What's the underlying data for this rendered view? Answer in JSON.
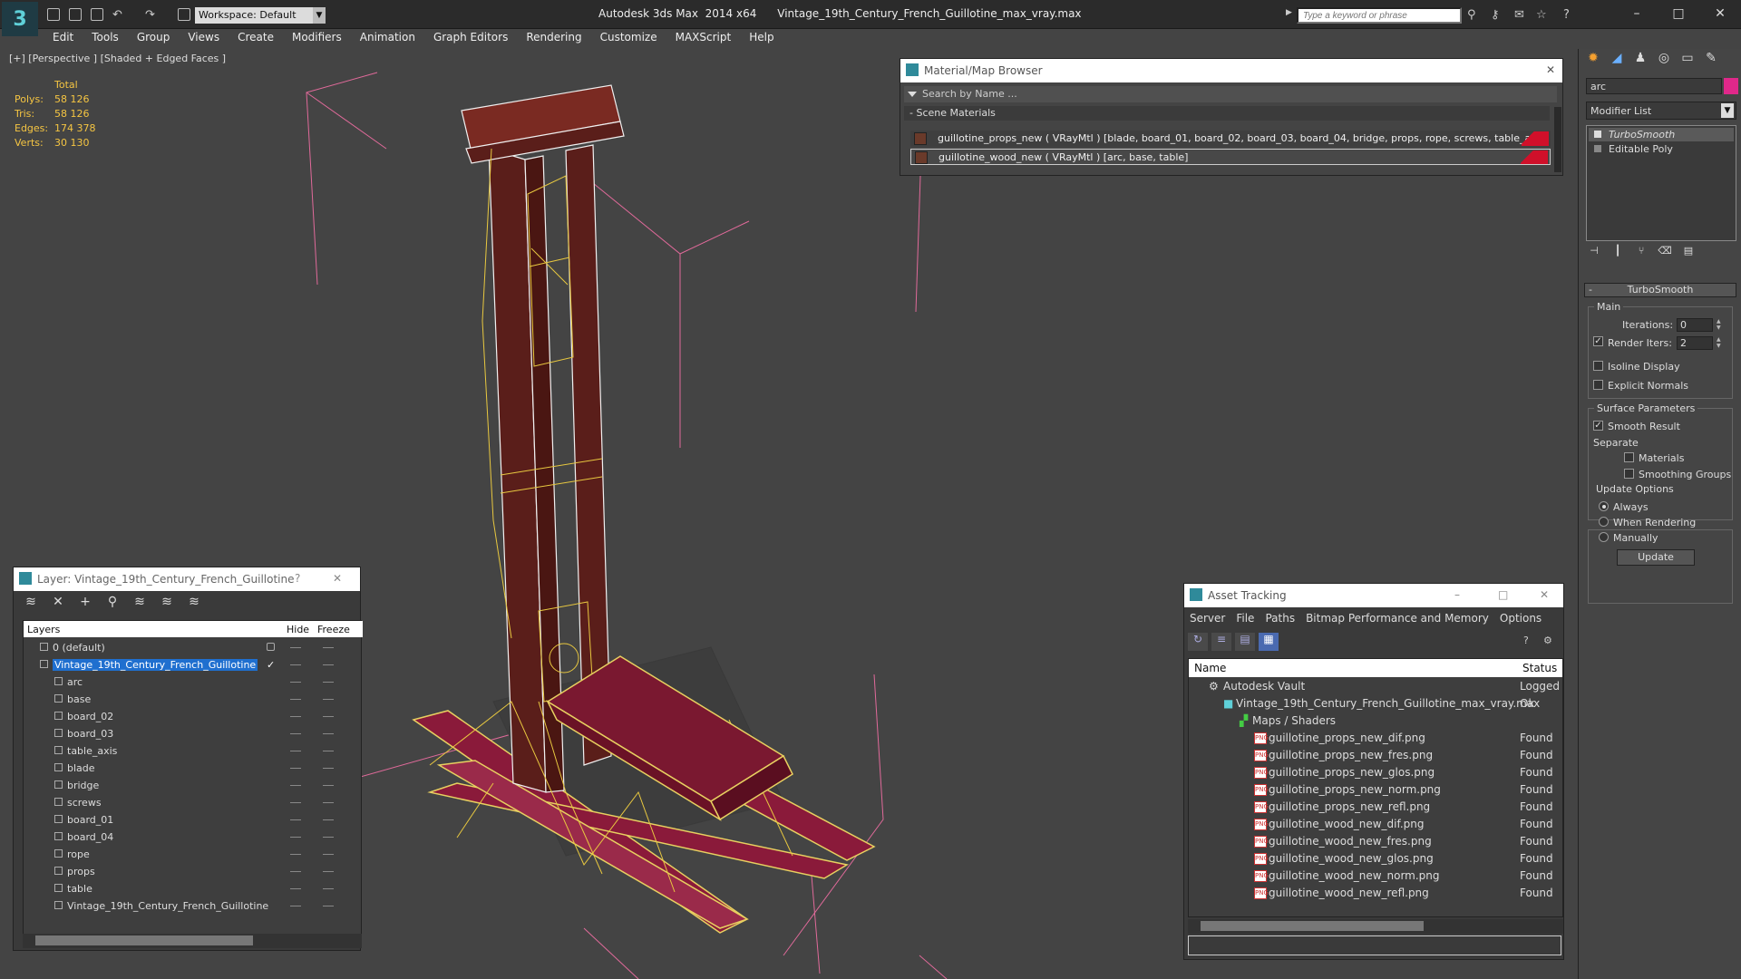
{
  "titlebar": {
    "app": "Autodesk 3ds Max  2014 x64",
    "file": "Vintage_19th_Century_French_Guillotine_max_vray.max",
    "workspace": "Workspace: Default",
    "search_placeholder": "Type a keyword or phrase"
  },
  "menu": [
    "Edit",
    "Tools",
    "Group",
    "Views",
    "Create",
    "Modifiers",
    "Animation",
    "Graph Editors",
    "Rendering",
    "Customize",
    "MAXScript",
    "Help"
  ],
  "viewport": {
    "label": "[+] [Perspective ] [Shaded + Edged Faces ]",
    "stats": {
      "total": "Total",
      "rows": [
        {
          "label": "Polys:",
          "value": "58 126"
        },
        {
          "label": "Tris:",
          "value": "58 126"
        },
        {
          "label": "Edges:",
          "value": "174 378"
        },
        {
          "label": "Verts:",
          "value": "30 130"
        }
      ]
    }
  },
  "material_browser": {
    "title": "Material/Map Browser",
    "search": "Search by Name ...",
    "group": "- Scene Materials",
    "items": [
      "guillotine_props_new  ( VRayMtl ) [blade, board_01, board_02, board_03, board_04, bridge, props, rope, screws, table_axis]",
      "guillotine_wood_new  ( VRayMtl ) [arc, base, table]"
    ]
  },
  "layer_window": {
    "title": "Layer: Vintage_19th_Century_French_Guillotine",
    "help": "?",
    "columns": {
      "layers": "Layers",
      "hide": "Hide",
      "freeze": "Freeze"
    },
    "layers": [
      {
        "name": "0 (default)"
      },
      {
        "name": "Vintage_19th_Century_French_Guillotine"
      }
    ],
    "objects": [
      "arc",
      "base",
      "board_02",
      "board_03",
      "table_axis",
      "blade",
      "bridge",
      "screws",
      "board_01",
      "board_04",
      "rope",
      "props",
      "table",
      "Vintage_19th_Century_French_Guillotine"
    ]
  },
  "asset_tracking": {
    "title": "Asset Tracking",
    "menu": [
      "Server",
      "File",
      "Paths",
      "Bitmap Performance and Memory",
      "Options"
    ],
    "columns": {
      "name": "Name",
      "status": "Status"
    },
    "vault": {
      "name": "Autodesk Vault",
      "status": "Logged O"
    },
    "file": {
      "name": "Vintage_19th_Century_French_Guillotine_max_vray.max",
      "status": "Ok"
    },
    "maps_group": "Maps / Shaders",
    "maps": [
      {
        "name": "guillotine_props_new_dif.png",
        "status": "Found"
      },
      {
        "name": "guillotine_props_new_fres.png",
        "status": "Found"
      },
      {
        "name": "guillotine_props_new_glos.png",
        "status": "Found"
      },
      {
        "name": "guillotine_props_new_norm.png",
        "status": "Found"
      },
      {
        "name": "guillotine_props_new_refl.png",
        "status": "Found"
      },
      {
        "name": "guillotine_wood_new_dif.png",
        "status": "Found"
      },
      {
        "name": "guillotine_wood_new_fres.png",
        "status": "Found"
      },
      {
        "name": "guillotine_wood_new_glos.png",
        "status": "Found"
      },
      {
        "name": "guillotine_wood_new_norm.png",
        "status": "Found"
      },
      {
        "name": "guillotine_wood_new_refl.png",
        "status": "Found"
      }
    ]
  },
  "command_panel": {
    "object_name": "arc",
    "object_color": "#e0288a",
    "modifier_list": "Modifier List",
    "stack": [
      "TurboSmooth",
      "Editable Poly"
    ],
    "rollout": "TurboSmooth",
    "main_group": "Main",
    "iterations_label": "Iterations:",
    "iterations_value": "0",
    "render_iters_label": "Render Iters:",
    "render_iters_value": "2",
    "isoline_display": "Isoline Display",
    "explicit_normals": "Explicit Normals",
    "surface_group": "Surface Parameters",
    "smooth_result": "Smooth Result",
    "separate": "Separate",
    "materials": "Materials",
    "smoothing_groups": "Smoothing Groups",
    "update_group": "Update Options",
    "always": "Always",
    "when_rendering": "When Rendering",
    "manually": "Manually",
    "update_button": "Update"
  }
}
